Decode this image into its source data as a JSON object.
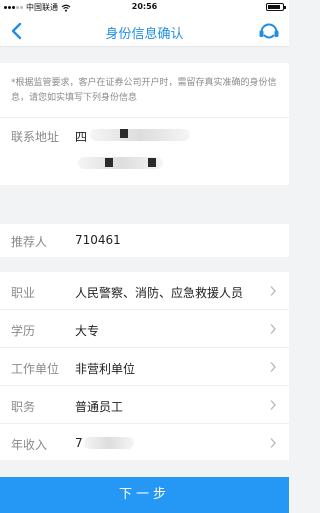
{
  "status_bar": {
    "carrier": "中国联通",
    "time": "20:56"
  },
  "nav": {
    "title": "身份信息确认",
    "back_icon": "chevron-left-icon",
    "service_icon": "customer-service-icon"
  },
  "notice": {
    "text": "*根据监管要求，客户在证券公司开户时，需留存真实准确的身份信息，请您如实填写下列身份信息"
  },
  "address": {
    "label": "联系地址",
    "value_visible": "四"
  },
  "referrer": {
    "label": "推荐人",
    "value": "710461"
  },
  "form": {
    "rows": [
      {
        "label": "职业",
        "value": "人民警察、消防、应急救援人员"
      },
      {
        "label": "学历",
        "value": "大专"
      },
      {
        "label": "工作单位",
        "value": "非营利单位"
      },
      {
        "label": "职务",
        "value": "普通员工"
      },
      {
        "label": "年收入",
        "value": "7"
      }
    ]
  },
  "footer": {
    "next_label": "下一步"
  },
  "colors": {
    "accent": "#1e8fe8",
    "button": "#2597f4",
    "background": "#f2f3f5"
  }
}
